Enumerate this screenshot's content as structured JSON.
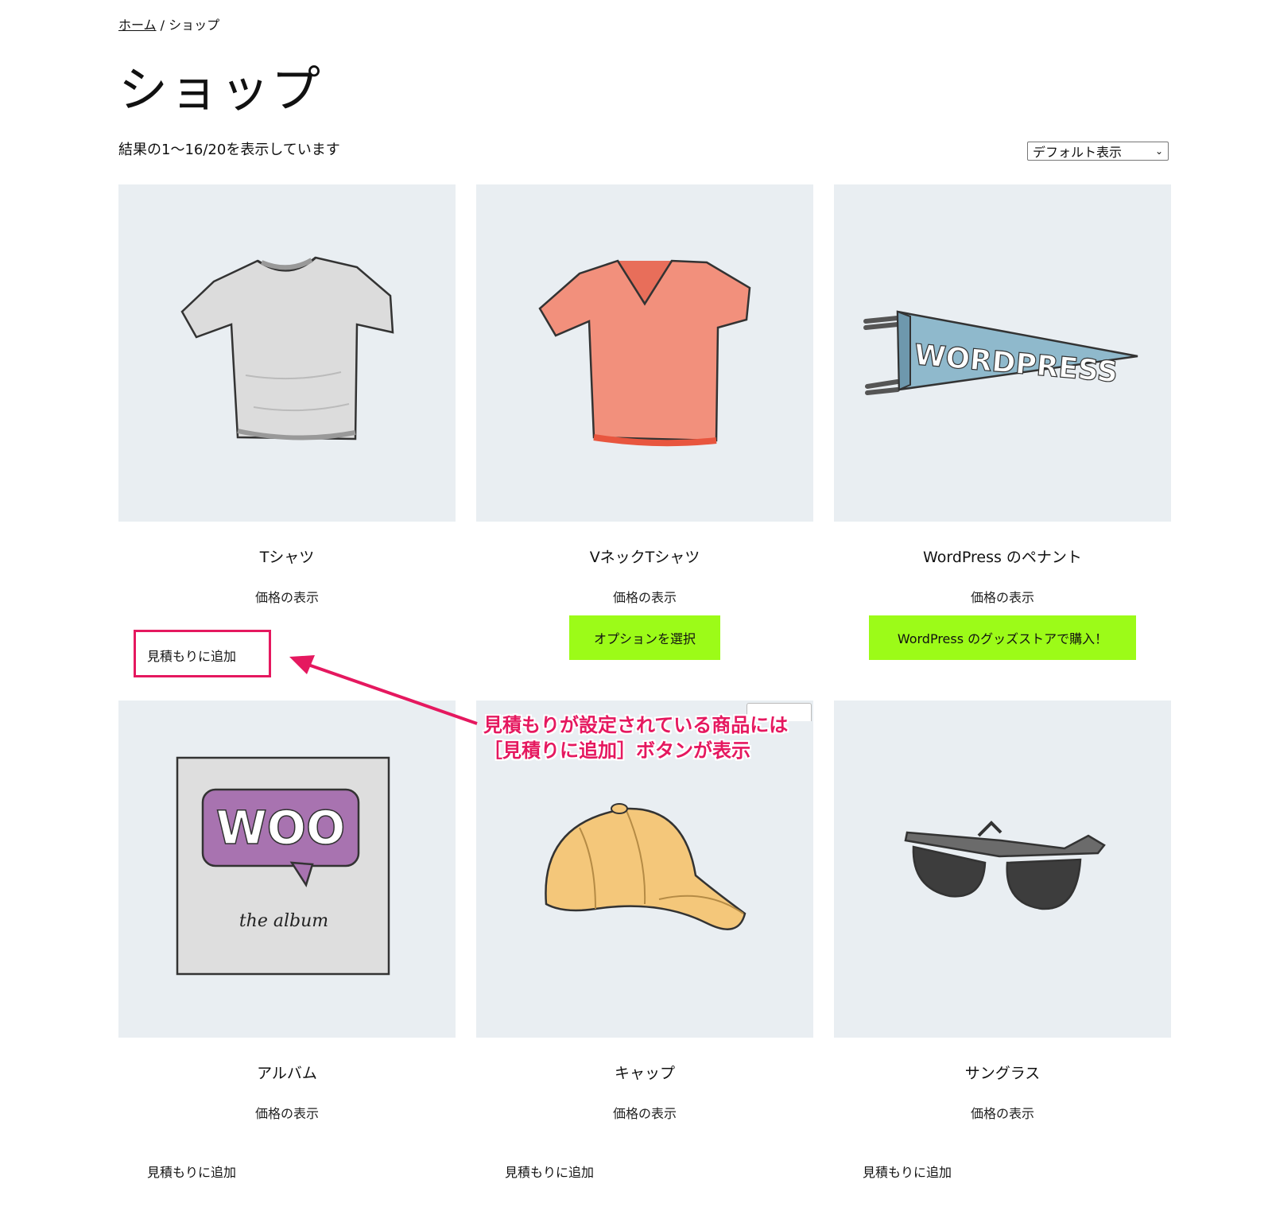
{
  "breadcrumb": {
    "home": "ホーム",
    "separator": " / ",
    "current": "ショップ"
  },
  "page_title": "ショップ",
  "result_count": "結果の1〜16/20を表示しています",
  "sort": {
    "selected": "デフォルト表示"
  },
  "products": [
    {
      "name": "Tシャツ",
      "price": "価格の表示",
      "action": "見積もりに追加"
    },
    {
      "name": "VネックTシャツ",
      "price": "価格の表示",
      "action": "オプションを選択"
    },
    {
      "name": "WordPress のペナント",
      "price": "価格の表示",
      "action": "WordPress のグッズストアで購入！"
    },
    {
      "name": "アルバム",
      "price": "価格の表示",
      "action": "見積もりに追加",
      "album_text": "WOO",
      "album_sub": "the album"
    },
    {
      "name": "キャップ",
      "price": "価格の表示",
      "action": "見積もりに追加"
    },
    {
      "name": "サングラス",
      "price": "価格の表示",
      "action": "見積もりに追加"
    }
  ],
  "pennant_text": "WORDPRESS",
  "annotation": {
    "line1": "見積もりが設定されている商品には",
    "line2": "［見積りに追加］ボタンが表示"
  },
  "colors": {
    "accent_button": "#9cfb18",
    "annotation": "#e5185f",
    "image_bg": "#e9eef2"
  }
}
